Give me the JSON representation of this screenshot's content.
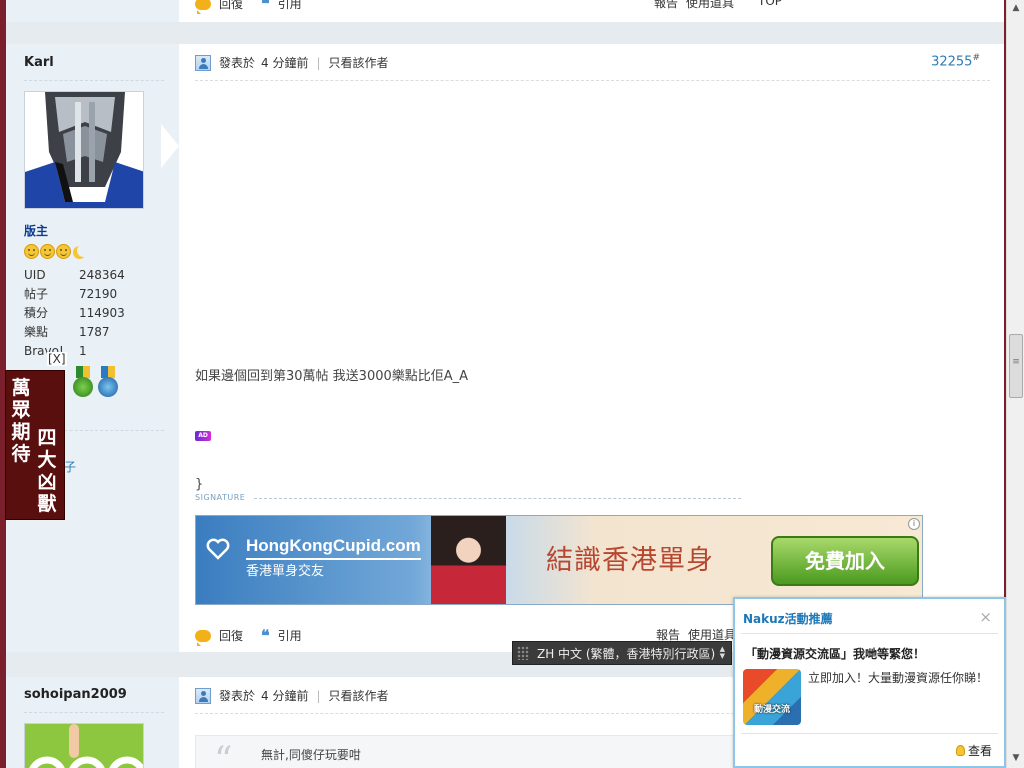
{
  "top_strip": {
    "reply_label": "回復",
    "quote_label": "引用",
    "report_label": "報告",
    "tools_label": "使用道具",
    "top_label": "TOP"
  },
  "post1": {
    "username": "Karl",
    "role": "版主",
    "stats": [
      {
        "key": "UID",
        "value": "248364"
      },
      {
        "key": "帖子",
        "value": "72190"
      },
      {
        "key": "積分",
        "value": "114903"
      },
      {
        "key": "樂點",
        "value": "1787"
      },
      {
        "key": "Bravo!",
        "value": "1"
      }
    ],
    "extra_text": "子",
    "posted_label": "發表於",
    "posted_time": "4 分鐘前",
    "separator": "|",
    "only_author": "只看該作者",
    "floor": "32255",
    "floor_mark": "#",
    "message": "如果邊個回到第30萬帖 我送3000樂點比佢A_A",
    "ad_badge": "AD",
    "brace": "}",
    "signature_label": "SIGNATURE",
    "banner": {
      "brand": "HongKongCupid.com",
      "brand_sub": "香港單身交友",
      "tagline": "結識香港單身",
      "cta": "免費加入",
      "info": "i"
    },
    "reply_label": "回復",
    "quote_label": "引用",
    "report_label": "報告",
    "tools_label": "使用道具"
  },
  "post2": {
    "username": "sohoipan2009",
    "posted_label": "發表於",
    "posted_time": "4 分鐘前",
    "separator": "|",
    "only_author": "只看該作者",
    "quote_text": "無計,同傻仔玩要咁"
  },
  "popup": {
    "title": "Nakuz活動推薦",
    "close": "×",
    "headline": "「動漫資源交流區」我哋等緊您！",
    "description": "立即加入！大量動漫資源任你睇！",
    "thumb_label": "動漫交流",
    "view_label": "查看"
  },
  "langbar": {
    "text": "ZH 中文 (繁體，香港特別行政區)"
  },
  "float_ad": {
    "close": "[X]",
    "col1": "萬眾期待",
    "col2": "四大凶獸"
  }
}
